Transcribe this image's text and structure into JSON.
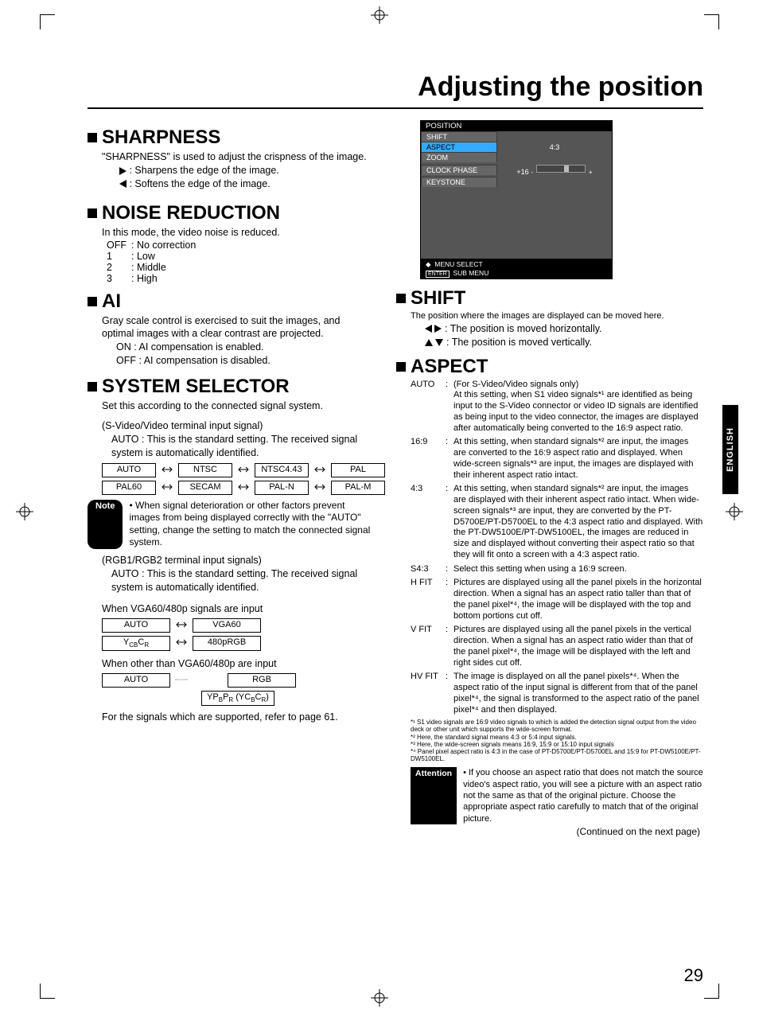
{
  "page_title": "Adjusting the position",
  "page_number": "29",
  "language_tab": "ENGLISH",
  "continued": "(Continued on the next page)",
  "sharpness": {
    "heading": "SHARPNESS",
    "intro": "\"SHARPNESS\" is used to adjust the crispness of the image.",
    "right": ": Sharpens the edge of the image.",
    "left": ": Softens the edge of the image."
  },
  "noise": {
    "heading": "NOISE REDUCTION",
    "intro": "In this mode, the video noise is reduced.",
    "rows": [
      {
        "k": "OFF",
        "v": ": No correction"
      },
      {
        "k": "1",
        "v": ": Low"
      },
      {
        "k": "2",
        "v": ": Middle"
      },
      {
        "k": "3",
        "v": ": High"
      }
    ]
  },
  "ai": {
    "heading": "AI",
    "intro": "Gray scale control is exercised to suit the images, and optimal images with a clear contrast are projected.",
    "on": "ON   : AI compensation is enabled.",
    "off": "OFF : AI compensation is disabled."
  },
  "sys": {
    "heading": "SYSTEM SELECTOR",
    "intro": "Set this according to the connected signal system.",
    "group1_label": "(S-Video/Video terminal input signal)",
    "auto_desc": "AUTO : This is the standard setting. The received signal system is automatically identified.",
    "row1": [
      "AUTO",
      "NTSC",
      "NTSC4.43",
      "PAL"
    ],
    "row2": [
      "PAL60",
      "SECAM",
      "PAL-N",
      "PAL-M"
    ],
    "note_label": "Note",
    "note_text": "• When signal deterioration or other factors prevent images from being displayed correctly with the \"AUTO\" setting, change the setting to match the connected signal system.",
    "group2_label": "(RGB1/RGB2 terminal input signals)",
    "vga_label": "When VGA60/480p signals are input",
    "vga_row1": [
      "AUTO",
      "VGA60"
    ],
    "vga_row2_a": "YCBCR",
    "vga_row2_b": "480pRGB",
    "other_label": "When other than VGA60/480p are input",
    "other_row1": [
      "AUTO",
      "RGB"
    ],
    "other_row2": "YPBPR (YCBCR)",
    "ref": "For the signals which are supported, refer to page 61."
  },
  "osd": {
    "title": "POSITION",
    "rows": [
      {
        "label": "SHIFT",
        "val": ""
      },
      {
        "label": "ASPECT",
        "val": "4:3",
        "sel": true
      },
      {
        "label": "ZOOM",
        "val": ""
      },
      {
        "label": "CLOCK PHASE",
        "val": "+16",
        "slider": true
      },
      {
        "label": "KEYSTONE",
        "val": ""
      }
    ],
    "foot1": "MENU SELECT",
    "foot2": "SUB MENU",
    "foot_btn": "ENTER"
  },
  "shift": {
    "heading": "SHIFT",
    "intro": "The position where the images are displayed can be moved here.",
    "h": ": The position is moved horizontally.",
    "v": ": The position is moved vertically."
  },
  "aspect": {
    "heading": "ASPECT",
    "items": [
      {
        "k": "AUTO",
        "v": "(For S-Video/Video signals only)\nAt this setting, when S1 video signals*¹ are identified as being input to the S-Video connector or video ID signals are identified as being input to the video connector, the images are displayed after automatically being converted to the 16:9 aspect ratio."
      },
      {
        "k": "16:9",
        "v": "At this setting, when standard signals*² are input, the images are converted to the 16:9 aspect ratio and displayed. When wide-screen signals*³ are input, the images are displayed with their inherent aspect ratio intact."
      },
      {
        "k": "4:3",
        "v": "At this setting, when standard signals*² are input, the images are displayed with their inherent aspect ratio intact. When wide-screen signals*³ are input, they are converted by the PT-D5700E/PT-D5700EL to the 4:3 aspect ratio and displayed. With the PT-DW5100E/PT-DW5100EL, the images are reduced in size and displayed without converting their aspect ratio so that they will fit onto a screen with a 4:3 aspect ratio."
      },
      {
        "k": "S4:3",
        "v": "Select this setting when using a 16:9 screen."
      },
      {
        "k": "H FIT",
        "v": "Pictures are displayed using all the panel pixels in the horizontal direction. When a signal has an aspect ratio taller than that of the panel pixel*⁴, the image will be displayed with the top and bottom portions cut off."
      },
      {
        "k": "V FIT",
        "v": "Pictures are displayed using all the panel pixels in the vertical direction. When a signal has an aspect ratio wider than that of the panel pixel*⁴, the image will be displayed with the left and right sides cut off."
      },
      {
        "k": "HV FIT",
        "v": "The image is displayed on all the panel pixels*⁴. When the aspect ratio of the input signal is different from that of the panel pixel*⁴, the signal is transformed to the aspect ratio of the panel pixel*⁴ and then displayed."
      }
    ],
    "footnotes": "*¹ S1 video signals are 16:9 video signals to which is added the detection signal output from the video deck or other unit which supports the wide-screen format.\n*² Here, the standard signal means 4:3 or 5:4 input signals.\n*³ Here, the wide-screen signals means 16:9, 15:9 or 15:10 input signals\n*⁴ Panel pixel aspect ratio is 4:3 in the case of PT-D5700E/PT-D5700EL and 15:9 for PT-DW5100E/PT-DW5100EL.",
    "attention_label": "Attention",
    "attention_text": "• If you choose an aspect ratio that does not match the source video's aspect ratio, you will see a picture with an aspect ratio not the same as that of the original picture. Choose the appropriate aspect ratio carefully to match that of the original picture."
  }
}
